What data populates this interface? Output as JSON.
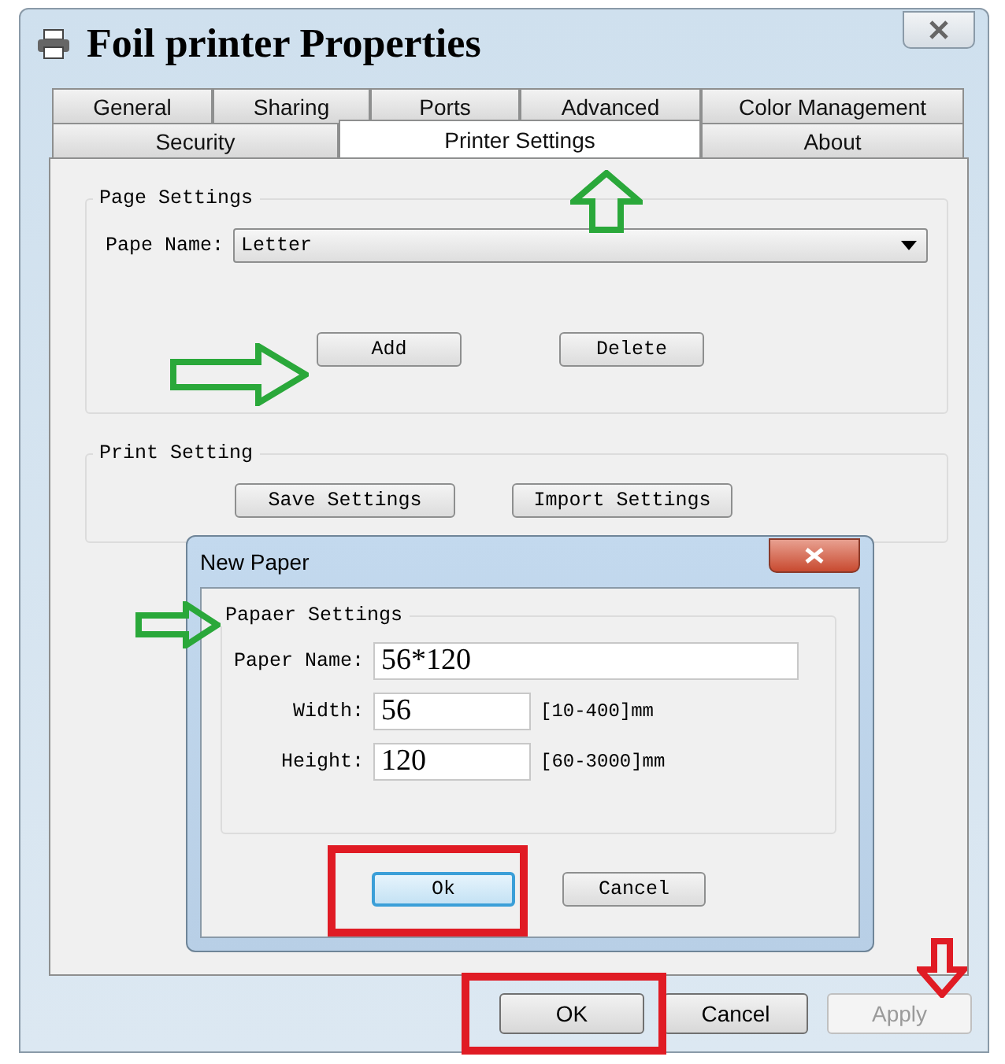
{
  "window": {
    "title": "Foil printer Properties"
  },
  "tabs": [
    [
      {
        "label": "General",
        "selected": false
      },
      {
        "label": "Sharing",
        "selected": false
      },
      {
        "label": "Ports",
        "selected": false
      },
      {
        "label": "Advanced",
        "selected": false
      },
      {
        "label": "Color Management",
        "selected": false
      }
    ],
    [
      {
        "label": "Security",
        "selected": false
      },
      {
        "label": "Printer Settings",
        "selected": true
      },
      {
        "label": "About",
        "selected": false
      }
    ]
  ],
  "page_settings": {
    "title": "Page Settings",
    "label": "Pape Name:",
    "value": "Letter",
    "buttons": [
      "Add",
      "Delete"
    ]
  },
  "print_setting": {
    "title": "Print Setting",
    "buttons": [
      "Save Settings",
      "Import Settings"
    ]
  },
  "dialog": {
    "title": "New Paper",
    "group_title": "Papaer Settings",
    "fields": [
      {
        "label": "Paper Name:",
        "value": "56*120"
      },
      {
        "label": "Width:",
        "value": "56",
        "hint": "[10-400]mm"
      },
      {
        "label": "Height:",
        "value": "120",
        "hint": "[60-3000]mm"
      }
    ],
    "buttons": [
      {
        "label": "Ok",
        "focused": true
      },
      {
        "label": "Cancel",
        "focused": false
      }
    ]
  },
  "buttons": [
    {
      "label": "OK",
      "disabled": false
    },
    {
      "label": "Cancel",
      "disabled": false
    },
    {
      "label": "Apply",
      "disabled": true
    }
  ]
}
